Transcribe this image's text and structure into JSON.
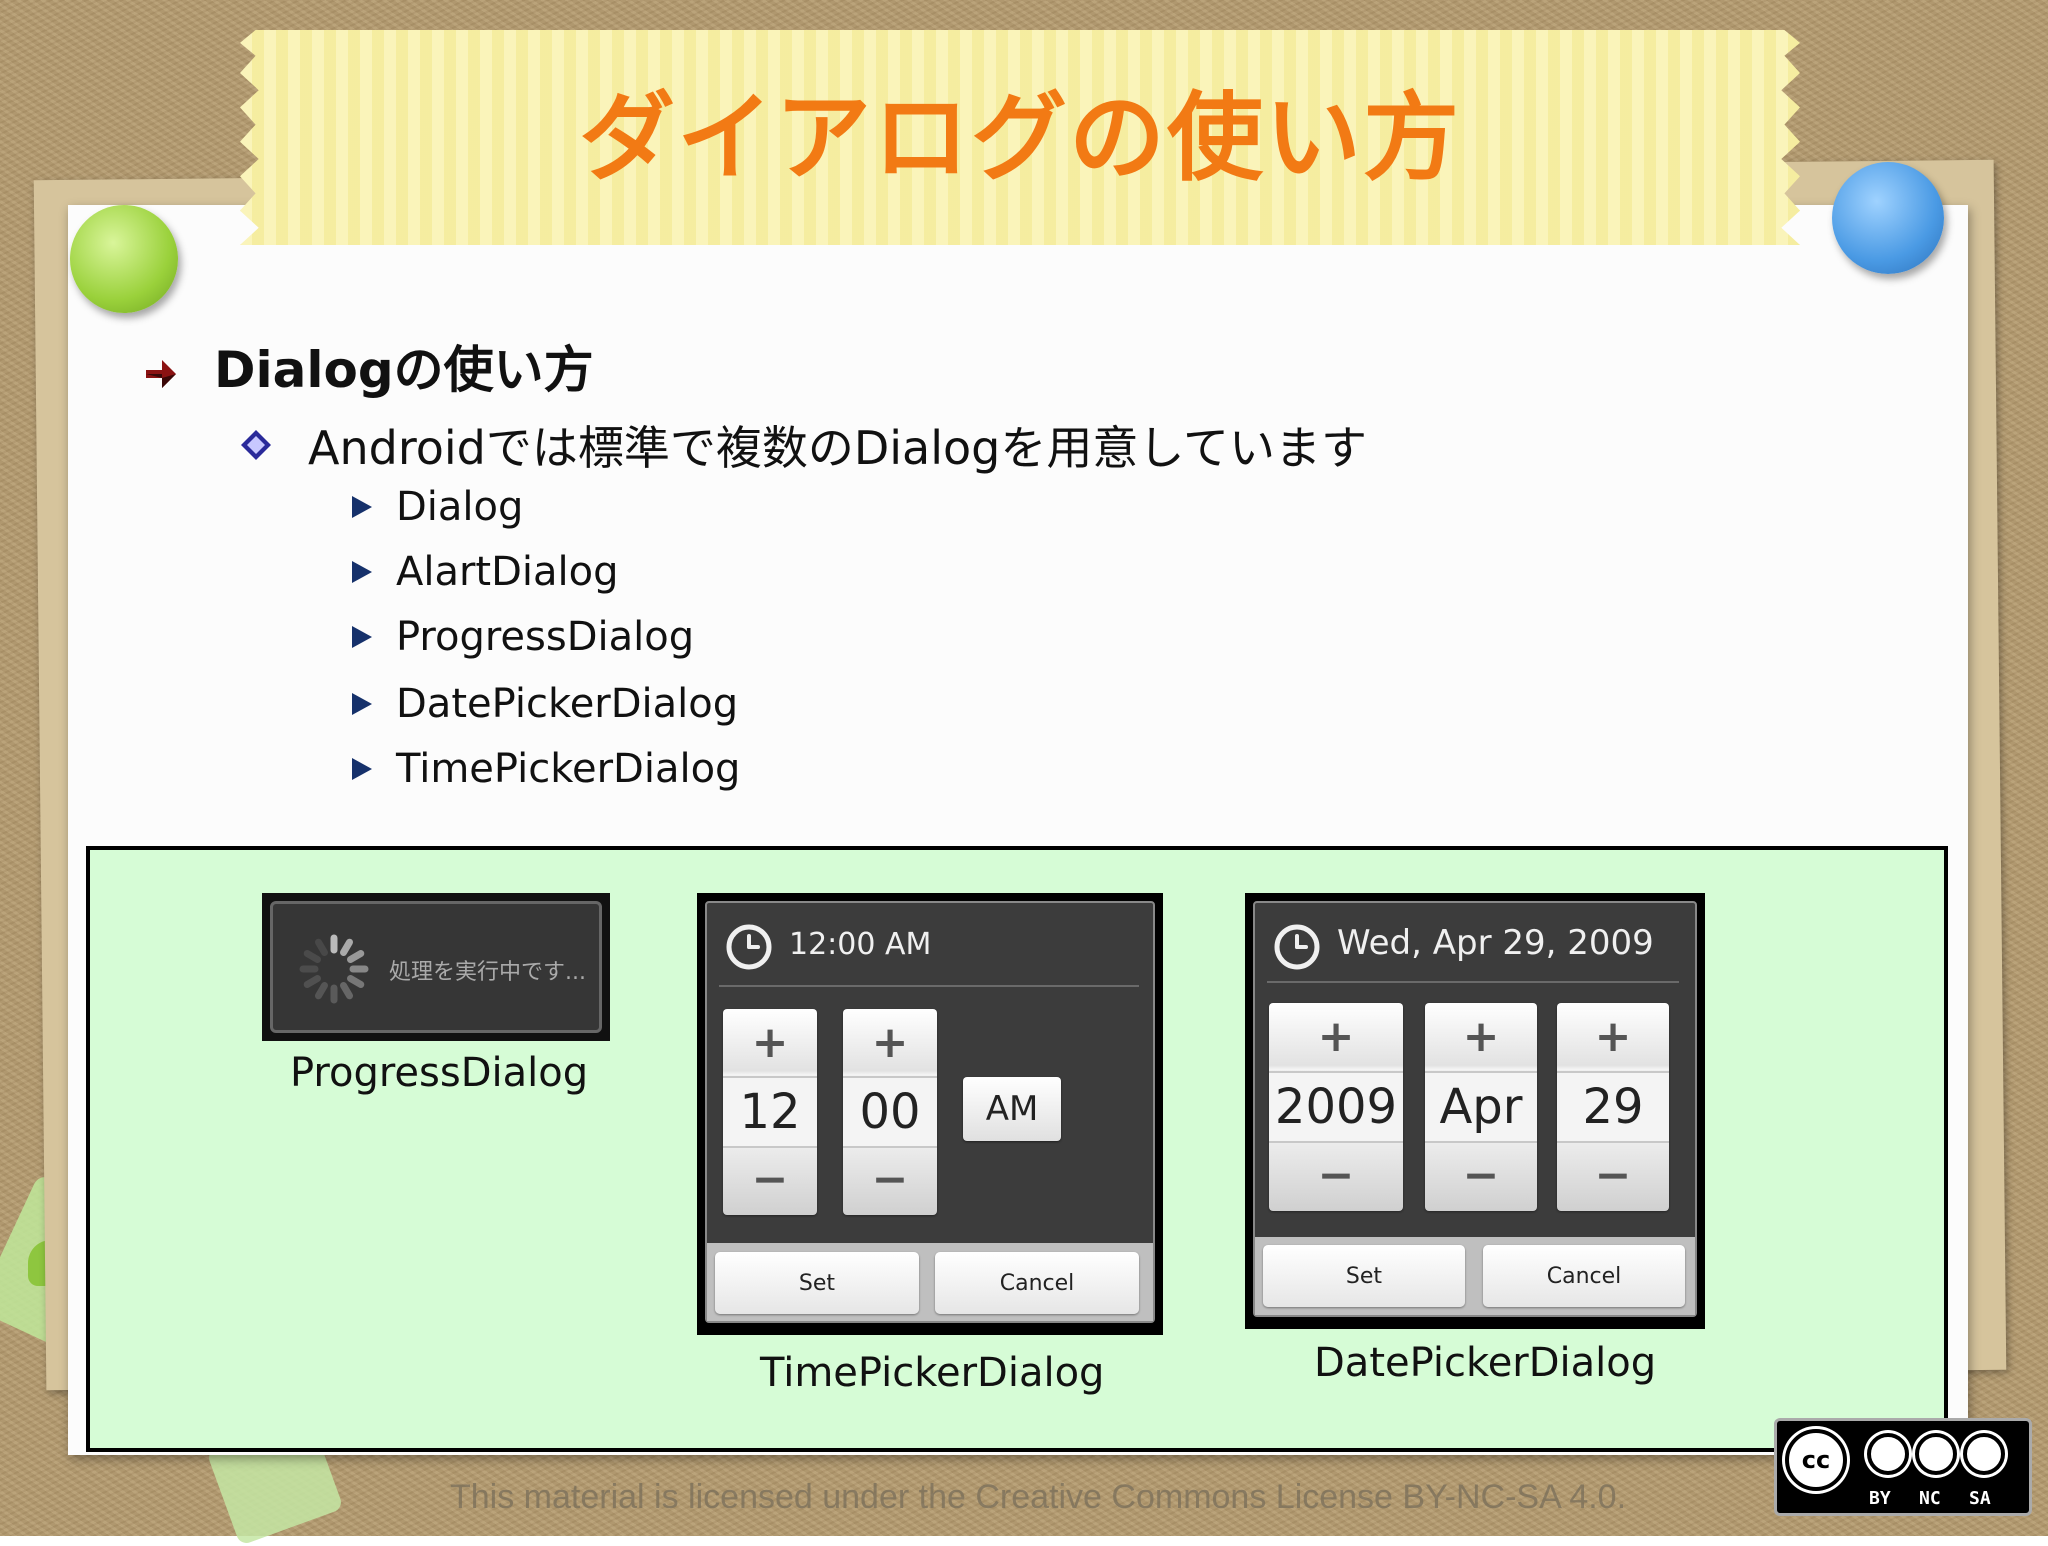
{
  "slide": {
    "title": "ダイアログの使い方",
    "heading": "Dialogの使い方",
    "subheading": "Androidでは標準で複数のDialogを用意しています",
    "items": [
      "Dialog",
      "AlartDialog",
      "ProgressDialog",
      "DatePickerDialog",
      "TimePickerDialog"
    ]
  },
  "progress_dialog": {
    "message": "処理を実行中です...",
    "caption": "ProgressDialog"
  },
  "time_picker": {
    "title": "12:00 AM",
    "hour": "12",
    "minute": "00",
    "ampm": "AM",
    "plus": "+",
    "minus": "−",
    "set_label": "Set",
    "cancel_label": "Cancel",
    "caption": "TimePickerDialog"
  },
  "date_picker": {
    "title": "Wed, Apr 29, 2009",
    "year": "2009",
    "month": "Apr",
    "day": "29",
    "plus": "+",
    "minus": "−",
    "set_label": "Set",
    "cancel_label": "Cancel",
    "caption": "DatePickerDialog"
  },
  "license": {
    "text": "This material is licensed under the Creative Commons License BY-NC-SA 4.0.",
    "badge_cc": "cc",
    "badge_by": "BY",
    "badge_nc": "NC",
    "badge_sa": "SA"
  },
  "icons": [
    "arrow-bullet-icon",
    "diamond-bullet-icon",
    "triangle-bullet-icon",
    "clock-icon",
    "spinner-icon",
    "cc-license-icon"
  ],
  "colors": {
    "title": "#f27a14",
    "panel_bg": "#d6fcd6",
    "tape": "#f8f0a3",
    "bullet_triangle": "#16316b",
    "pin_green": "#9ad13b",
    "pin_blue": "#4a9ae4"
  }
}
